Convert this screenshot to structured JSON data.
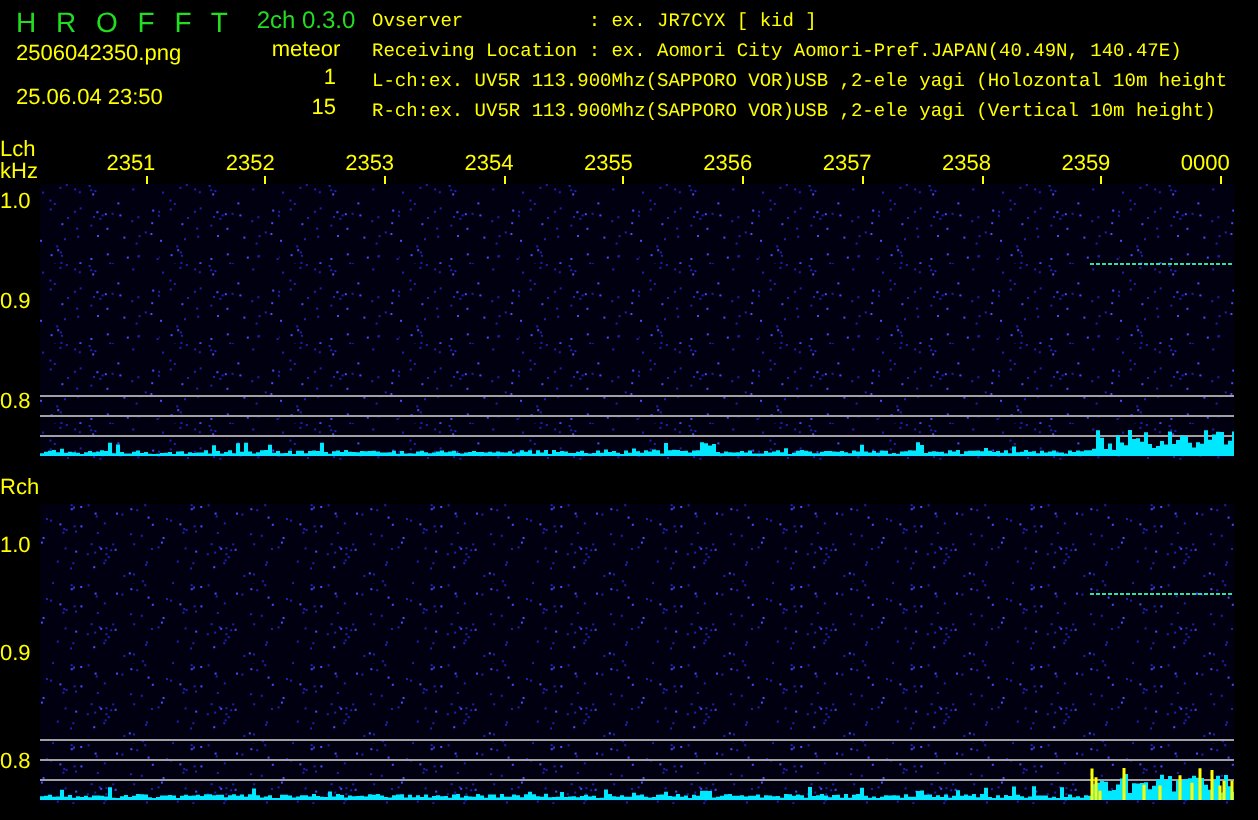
{
  "app": {
    "title": "H R O F F T",
    "version": "2ch 0.3.0",
    "filename": "2506042350.png",
    "timestamp": "25.06.04 23:50",
    "meteor_label": "meteor",
    "meteor_counts": [
      "1",
      "15"
    ]
  },
  "info_lines": [
    "Ovserver           : ex. JR7CYX [ kid ]",
    "Receiving Location : ex. Aomori City Aomori-Pref.JAPAN(40.49N, 140.47E)",
    "L-ch:ex. UV5R 113.900Mhz(SAPPORO VOR)USB ,2-ele yagi (Holozontal 10m height",
    "R-ch:ex. UV5R 113.900Mhz(SAPPORO VOR)USB ,2-ele yagi (Vertical 10m height)"
  ],
  "time_axis": [
    "2351",
    "2352",
    "2353",
    "2354",
    "2355",
    "2356",
    "2357",
    "2358",
    "2359",
    "0000"
  ],
  "channels": [
    {
      "name": "Lch",
      "unit": "kHz",
      "ticks": [
        "1.0",
        "0.9",
        "0.8"
      ]
    },
    {
      "name": "Rch",
      "ticks": [
        "1.0",
        "0.9",
        "0.8"
      ]
    }
  ]
}
